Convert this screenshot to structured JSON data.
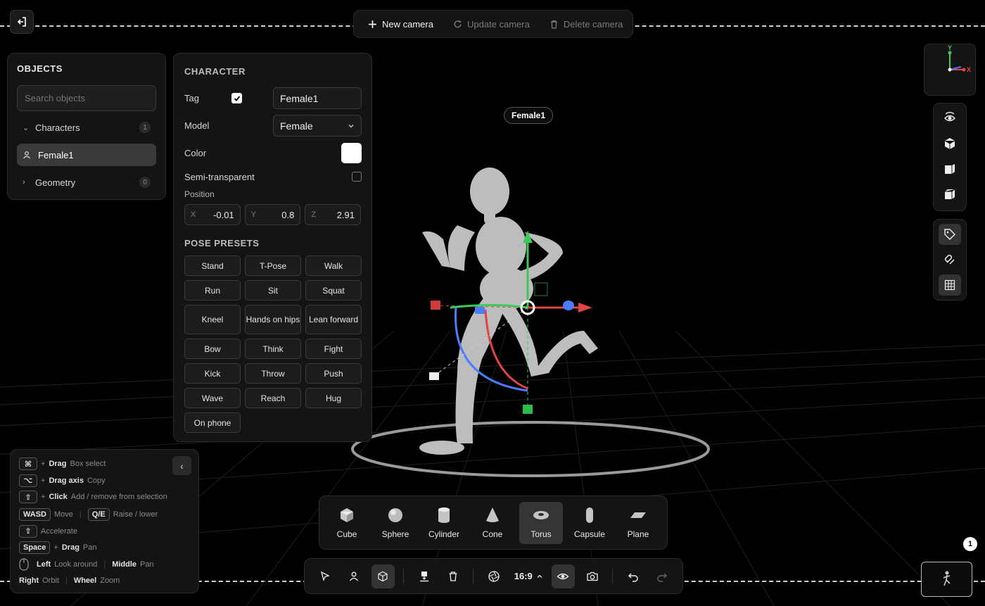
{
  "camera_bar": {
    "new_label": "New camera",
    "update_label": "Update camera",
    "delete_label": "Delete camera"
  },
  "objects": {
    "title": "OBJECTS",
    "search_placeholder": "Search objects",
    "groups": [
      {
        "label": "Characters",
        "count": "1",
        "expanded": true
      },
      {
        "label": "Geometry",
        "count": "0",
        "expanded": false
      }
    ],
    "selected_item": "Female1"
  },
  "character": {
    "title": "CHARACTER",
    "tag_label": "Tag",
    "tag_checked": true,
    "tag_value": "Female1",
    "model_label": "Model",
    "model_value": "Female",
    "color_label": "Color",
    "color_value": "#ffffff",
    "semi_label": "Semi-transparent",
    "semi_checked": false,
    "position_label": "Position",
    "position": {
      "x_axis": "X",
      "x": "-0.01",
      "y_axis": "Y",
      "y": "0.8",
      "z_axis": "Z",
      "z": "2.91"
    }
  },
  "pose_presets": {
    "title": "POSE PRESETS",
    "items": [
      "Stand",
      "T-Pose",
      "Walk",
      "Run",
      "Sit",
      "Squat",
      "Kneel",
      "Hands on hips",
      "Lean forward",
      "Bow",
      "Think",
      "Fight",
      "Kick",
      "Throw",
      "Push",
      "Wave",
      "Reach",
      "Hug",
      "On phone"
    ]
  },
  "scene": {
    "character_tag": "Female1",
    "gizmo_axes": {
      "y": "Y",
      "x": "X"
    },
    "axis_colors": {
      "x": "#e04444",
      "y": "#3dcc5a",
      "z": "#4a7dff"
    }
  },
  "shortcuts": {
    "rows": [
      {
        "key": "⌘",
        "plus": "+",
        "action": "Drag",
        "desc": "Box select"
      },
      {
        "key": "⌥",
        "plus": "+",
        "action": "Drag axis",
        "desc": "Copy"
      },
      {
        "key": "⇧",
        "plus": "+",
        "action": "Click",
        "desc": "Add / remove from selection"
      }
    ],
    "wasd_key": "WASD",
    "wasd_desc": "Move",
    "qe_key": "Q/E",
    "qe_desc": "Raise / lower",
    "shift_key": "⇧",
    "accel_desc": "Accelerate",
    "space_key": "Space",
    "space_plus": "+",
    "space_action": "Drag",
    "space_desc": "Pan",
    "left_action": "Left",
    "left_desc": "Look around",
    "middle_action": "Middle",
    "middle_desc": "Pan",
    "right_action": "Right",
    "right_desc": "Orbit",
    "wheel_action": "Wheel",
    "wheel_desc": "Zoom"
  },
  "shapes": {
    "items": [
      "Cube",
      "Sphere",
      "Cylinder",
      "Cone",
      "Torus",
      "Capsule",
      "Plane"
    ],
    "active": "Torus"
  },
  "bottom_bar": {
    "ratio": "16:9"
  },
  "notification_count": "1"
}
